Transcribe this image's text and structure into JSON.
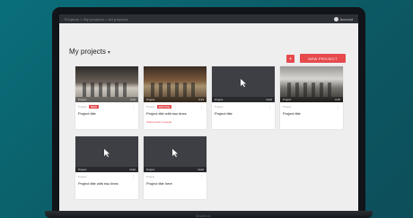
{
  "laptop": {
    "brand": "MacBook"
  },
  "topbar": {
    "breadcrumb": "Projects  >  My projects  >  All projects",
    "account": "Account"
  },
  "page": {
    "title": "My projects",
    "new_button": "NEW PROJECT",
    "square_button": "+"
  },
  "projects": [
    {
      "thumb": "photo1",
      "meta": "Project",
      "tag": "NEW",
      "name": "Project title",
      "sub": "",
      "bar_left": "Project",
      "bar_right": "0:12"
    },
    {
      "thumb": "photo2",
      "meta": "Project",
      "tag": "EDITING",
      "name": "Project title with two lines",
      "sub": "Shared with 2 people",
      "bar_left": "Project",
      "bar_right": "0:24"
    },
    {
      "thumb": "dark",
      "meta": "Project",
      "tag": "",
      "name": "Project title",
      "sub": "",
      "bar_left": "Project",
      "bar_right": "Draft"
    },
    {
      "thumb": "photo3",
      "meta": "Project",
      "tag": "",
      "name": "Project title",
      "sub": "",
      "bar_left": "Project",
      "bar_right": "0:45"
    },
    {
      "thumb": "dark",
      "meta": "Project",
      "tag": "",
      "name": "Project title with two lines",
      "sub": "",
      "bar_left": "Project",
      "bar_right": "Draft"
    },
    {
      "thumb": "dark",
      "meta": "Project",
      "tag": "",
      "name": "Project title here",
      "sub": "",
      "bar_left": "Project",
      "bar_right": "Draft"
    }
  ]
}
